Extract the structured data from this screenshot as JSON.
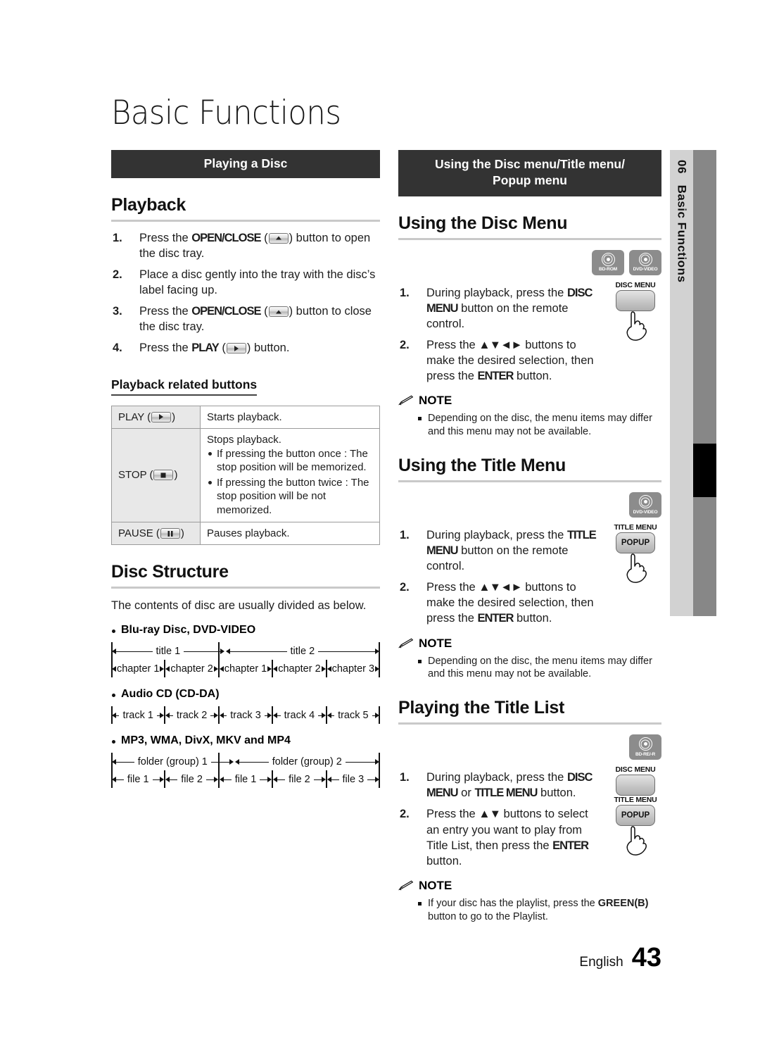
{
  "page": {
    "chapter_title": "Basic Functions",
    "footer_language": "English",
    "footer_page_number": "43",
    "tab_number": "06",
    "tab_label": "Basic Functions",
    "accent_bar_color": "#333333",
    "tab_light_color": "#d2d2d2",
    "tab_dark_color": "#878787"
  },
  "left": {
    "section_bar": "Playing a Disc",
    "playback": {
      "heading": "Playback",
      "steps": [
        {
          "num": "1.",
          "parts": [
            {
              "t": "Press the ",
              "bold": false
            },
            {
              "t": "OPEN/CLOSE",
              "bold": true
            },
            {
              "t": " (",
              "bold": false
            },
            {
              "t": "__KEY_EJECT__",
              "bold": false
            },
            {
              "t": ") button to open the disc tray.",
              "bold": false
            }
          ]
        },
        {
          "num": "2.",
          "parts": [
            {
              "t": "Place a disc gently into the tray with the disc’s label facing up.",
              "bold": false
            }
          ]
        },
        {
          "num": "3.",
          "parts": [
            {
              "t": "Press the ",
              "bold": false
            },
            {
              "t": "OPEN/CLOSE",
              "bold": true
            },
            {
              "t": " (",
              "bold": false
            },
            {
              "t": "__KEY_EJECT__",
              "bold": false
            },
            {
              "t": ") button to close the disc tray.",
              "bold": false
            }
          ]
        },
        {
          "num": "4.",
          "parts": [
            {
              "t": "Press the ",
              "bold": false
            },
            {
              "t": "PLAY",
              "bold": true
            },
            {
              "t": " (",
              "bold": false
            },
            {
              "t": "__KEY_PLAY__",
              "bold": false
            },
            {
              "t": ") button.",
              "bold": false
            }
          ]
        }
      ],
      "sub_heading": "Playback related buttons",
      "table": [
        {
          "label": "PLAY",
          "key": "play",
          "desc": "Starts playback.",
          "sub": []
        },
        {
          "label": "STOP",
          "key": "stop",
          "desc": "Stops playback.",
          "sub": [
            "If pressing the button once : The stop position will be memorized.",
            "If pressing the button twice : The stop position will be not memorized."
          ]
        },
        {
          "label": "PAUSE",
          "key": "pause",
          "desc": "Pauses playback.",
          "sub": []
        }
      ]
    },
    "disc_structure": {
      "heading": "Disc Structure",
      "intro": "The contents of disc are usually divided as below.",
      "groups": [
        {
          "label": "Blu-ray Disc, DVD-VIDEO",
          "rows": [
            {
              "cells": [
                {
                  "text": "title 1",
                  "flex": 2
                },
                {
                  "text": "title 2",
                  "flex": 3
                }
              ]
            },
            {
              "cells": [
                {
                  "text": "chapter 1",
                  "flex": 1
                },
                {
                  "text": "chapter 2",
                  "flex": 1
                },
                {
                  "text": "chapter 1",
                  "flex": 1
                },
                {
                  "text": "chapter 2",
                  "flex": 1
                },
                {
                  "text": "chapter 3",
                  "flex": 1
                }
              ]
            }
          ]
        },
        {
          "label": "Audio CD (CD-DA)",
          "rows": [
            {
              "cells": [
                {
                  "text": "track 1",
                  "flex": 1
                },
                {
                  "text": "track 2",
                  "flex": 1
                },
                {
                  "text": "track 3",
                  "flex": 1
                },
                {
                  "text": "track 4",
                  "flex": 1
                },
                {
                  "text": "track 5",
                  "flex": 1
                }
              ]
            }
          ]
        },
        {
          "label": "MP3, WMA, DivX, MKV and MP4",
          "rows": [
            {
              "cells": [
                {
                  "text": "folder (group) 1",
                  "flex": 2
                },
                {
                  "text": "folder (group) 2",
                  "flex": 3
                }
              ]
            },
            {
              "cells": [
                {
                  "text": "file 1",
                  "flex": 1
                },
                {
                  "text": "file 2",
                  "flex": 1
                },
                {
                  "text": "file 1",
                  "flex": 1
                },
                {
                  "text": "file 2",
                  "flex": 1
                },
                {
                  "text": "file 3",
                  "flex": 1
                }
              ]
            }
          ]
        }
      ]
    }
  },
  "right": {
    "section_bar_line1": "Using the Disc menu/Title menu/",
    "section_bar_line2": "Popup menu",
    "disc_menu": {
      "heading": "Using the Disc Menu",
      "badges": [
        {
          "label": "BD-ROM"
        },
        {
          "label": "DVD-VIDEO"
        }
      ],
      "remote": [
        {
          "label": "DISC MENU",
          "caption": ""
        }
      ],
      "steps": [
        {
          "num": "1.",
          "parts": [
            {
              "t": "During playback, press the ",
              "bold": false
            },
            {
              "t": "DISC MENU",
              "bold": true
            },
            {
              "t": " button on the remote control.",
              "bold": false
            }
          ]
        },
        {
          "num": "2.",
          "parts": [
            {
              "t": "Press the ",
              "bold": false
            },
            {
              "t": "▲▼◄►",
              "bold": true
            },
            {
              "t": " buttons to make the desired selection, then press the ",
              "bold": false
            },
            {
              "t": "ENTER",
              "bold": true
            },
            {
              "t": " button.",
              "bold": false
            }
          ]
        }
      ],
      "note_title": "NOTE",
      "notes": [
        "Depending on the disc, the menu items may differ and this menu may not be available."
      ]
    },
    "title_menu": {
      "heading": "Using the Title Menu",
      "badges": [
        {
          "label": "DVD-VIDEO"
        }
      ],
      "remote": [
        {
          "label": "TITLE MENU",
          "caption": "POPUP"
        }
      ],
      "steps": [
        {
          "num": "1.",
          "parts": [
            {
              "t": "During playback, press the ",
              "bold": false
            },
            {
              "t": "TITLE MENU",
              "bold": true
            },
            {
              "t": " button on the remote control.",
              "bold": false
            }
          ]
        },
        {
          "num": "2.",
          "parts": [
            {
              "t": "Press the ",
              "bold": false
            },
            {
              "t": "▲▼◄►",
              "bold": true
            },
            {
              "t": " buttons to make the desired selection, then press the ",
              "bold": false
            },
            {
              "t": "ENTER",
              "bold": true
            },
            {
              "t": " button.",
              "bold": false
            }
          ]
        }
      ],
      "note_title": "NOTE",
      "notes": [
        "Depending on the disc, the menu items may differ and this menu may not be available."
      ]
    },
    "title_list": {
      "heading": "Playing the Title List",
      "badges": [
        {
          "label": "BD-RE/-R"
        }
      ],
      "remote": [
        {
          "label": "DISC MENU",
          "caption": ""
        },
        {
          "label": "TITLE MENU",
          "caption": "POPUP"
        }
      ],
      "steps": [
        {
          "num": "1.",
          "parts": [
            {
              "t": "During playback, press the ",
              "bold": false
            },
            {
              "t": "DISC MENU",
              "bold": true
            },
            {
              "t": " or ",
              "bold": false
            },
            {
              "t": "TITLE MENU",
              "bold": true
            },
            {
              "t": " button.",
              "bold": false
            }
          ]
        },
        {
          "num": "2.",
          "parts": [
            {
              "t": "Press the ",
              "bold": false
            },
            {
              "t": "▲▼",
              "bold": true
            },
            {
              "t": " buttons to select an entry you want to play from Title List, then press the ",
              "bold": false
            },
            {
              "t": "ENTER",
              "bold": true
            },
            {
              "t": " button.",
              "bold": false
            }
          ]
        }
      ],
      "note_title": "NOTE",
      "notes": [
        "If your disc has the playlist, press the __BOLD__GREEN(B)__/BOLD__ button to go to the Playlist."
      ]
    }
  }
}
